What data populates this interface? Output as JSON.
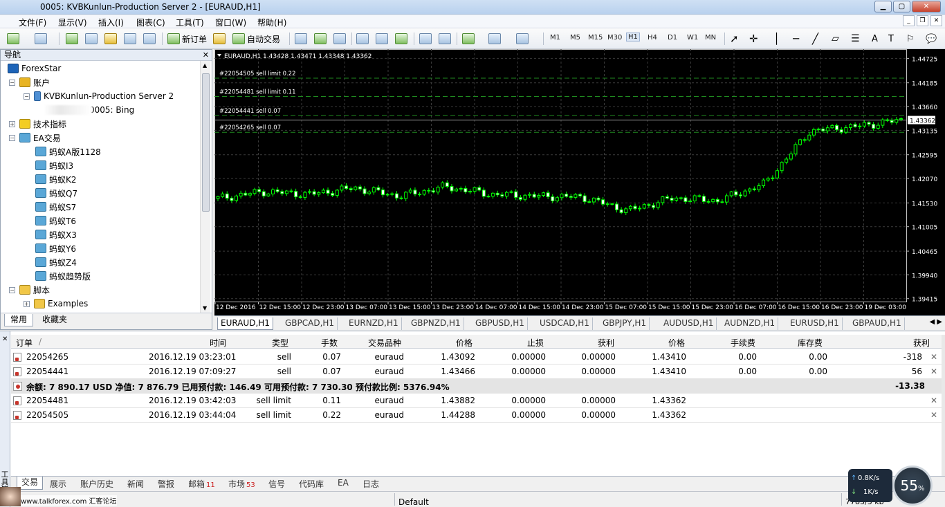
{
  "window": {
    "title": "0005: KVBKunlun-Production Server 2 - [EURAUD,H1]"
  },
  "menu": [
    "文件(F)",
    "显示(V)",
    "插入(I)",
    "图表(C)",
    "工具(T)",
    "窗口(W)",
    "帮助(H)"
  ],
  "toolbar": {
    "new_order": "新订单",
    "auto_trade": "自动交易",
    "timeframes": [
      "M1",
      "M5",
      "M15",
      "M30",
      "H1",
      "H4",
      "D1",
      "W1",
      "MN"
    ],
    "selected_timeframe": "H1"
  },
  "navigator": {
    "title": "导航",
    "items": [
      {
        "label": "ForexStar",
        "level": 0,
        "icon": "fx-icon"
      },
      {
        "label": "账户",
        "level": 1,
        "icon": "accounts-icon"
      },
      {
        "label": "KVBKunlun-Production Server 2",
        "level": 2,
        "icon": "server-icon"
      },
      {
        "label": "0005: Bing",
        "level": 3,
        "icon": "account-icon"
      },
      {
        "label": "技术指标",
        "level": 1,
        "icon": "indicator-icon"
      },
      {
        "label": "EA交易",
        "level": 1,
        "icon": "ea-icon"
      },
      {
        "label": "蚂蚁A版1128",
        "level": 2,
        "icon": "ea-icon"
      },
      {
        "label": "蚂蚁I3",
        "level": 2,
        "icon": "ea-icon"
      },
      {
        "label": "蚂蚁K2",
        "level": 2,
        "icon": "ea-icon"
      },
      {
        "label": "蚂蚁Q7",
        "level": 2,
        "icon": "ea-icon"
      },
      {
        "label": "蚂蚁S7",
        "level": 2,
        "icon": "ea-icon"
      },
      {
        "label": "蚂蚁T6",
        "level": 2,
        "icon": "ea-icon"
      },
      {
        "label": "蚂蚁X3",
        "level": 2,
        "icon": "ea-icon"
      },
      {
        "label": "蚂蚁Y6",
        "level": 2,
        "icon": "ea-icon"
      },
      {
        "label": "蚂蚁Z4",
        "level": 2,
        "icon": "ea-icon"
      },
      {
        "label": "蚂蚁趋势版",
        "level": 2,
        "icon": "ea-icon"
      },
      {
        "label": "脚本",
        "level": 1,
        "icon": "script-icon"
      },
      {
        "label": "Examples",
        "level": 2,
        "icon": "script-icon"
      }
    ],
    "tabs": [
      "常用",
      "收藏夹"
    ]
  },
  "chart": {
    "header": "EURAUD,H1  1.43428 1.43471 1.43348 1.43362",
    "current_price": "1.43362",
    "order_lines": [
      {
        "label": "#22054505 sell limit 0.22",
        "price": 1.44288
      },
      {
        "label": "#22054481 sell limit 0.11",
        "price": 1.43882
      },
      {
        "label": "#22054441 sell 0.07",
        "price": 1.43466
      },
      {
        "label": "#22054265 sell 0.07",
        "price": 1.43092
      }
    ],
    "price_axis": [
      "1.44725",
      "1.44185",
      "1.43660",
      "1.43135",
      "1.42595",
      "1.42070",
      "1.41530",
      "1.41005",
      "1.40465",
      "1.39940",
      "1.39415"
    ],
    "time_axis": [
      "12 Dec 2016",
      "12 Dec 15:00",
      "12 Dec 23:00",
      "13 Dec 07:00",
      "13 Dec 15:00",
      "13 Dec 23:00",
      "14 Dec 07:00",
      "14 Dec 15:00",
      "14 Dec 23:00",
      "15 Dec 07:00",
      "15 Dec 15:00",
      "15 Dec 23:00",
      "16 Dec 07:00",
      "16 Dec 15:00",
      "16 Dec 23:00",
      "19 Dec 03:00"
    ],
    "colors": {
      "background": "#000000",
      "candle": "#00ff00",
      "grid": "#3a3a3a",
      "order_line": "#1f8a1f"
    }
  },
  "chart_data": {
    "type": "candlestick",
    "symbol": "EURAUD",
    "timeframe": "H1",
    "x": [
      "12 Dec 2016",
      "12 Dec 15:00",
      "12 Dec 23:00",
      "13 Dec 07:00",
      "13 Dec 15:00",
      "13 Dec 23:00",
      "14 Dec 07:00",
      "14 Dec 15:00",
      "14 Dec 23:00",
      "15 Dec 07:00",
      "15 Dec 15:00",
      "15 Dec 23:00",
      "16 Dec 07:00",
      "16 Dec 15:00",
      "16 Dec 23:00",
      "19 Dec 03:00"
    ],
    "close_series": [
      1.4163,
      1.4178,
      1.4172,
      1.4186,
      1.4168,
      1.4189,
      1.4172,
      1.4168,
      1.4166,
      1.4136,
      1.4164,
      1.4158,
      1.4195,
      1.4312,
      1.4322,
      1.4336
    ],
    "ylim": [
      1.3935,
      1.4493
    ],
    "grid": true
  },
  "chart_tabs": [
    "EURAUD,H1",
    "GBPCAD,H1",
    "EURNZD,H1",
    "GBPNZD,H1",
    "GBPUSD,H1",
    "USDCAD,H1",
    "GBPJPY,H1",
    "AUDUSD,H1",
    "AUDNZD,H1",
    "EURUSD,H1",
    "GBPAUD,H1"
  ],
  "terminal": {
    "columns": [
      "订单",
      "时间",
      "类型",
      "手数",
      "交易品种",
      "价格",
      "止损",
      "获利",
      "价格",
      "手续费",
      "库存费",
      "获利"
    ],
    "rows": [
      [
        "22054265",
        "2016.12.19 03:23:01",
        "sell",
        "0.07",
        "euraud",
        "1.43092",
        "0.00000",
        "0.00000",
        "1.43410",
        "0.00",
        "0.00",
        "-318"
      ],
      [
        "22054441",
        "2016.12.19 07:09:27",
        "sell",
        "0.07",
        "euraud",
        "1.43466",
        "0.00000",
        "0.00000",
        "1.43410",
        "0.00",
        "0.00",
        "56"
      ]
    ],
    "summary": {
      "text": "余额: 7 890.17 USD  净值: 7 876.79  已用预付款: 146.49  可用预付款: 7 730.30  预付款比例: 5376.94%",
      "profit": "-13.38"
    },
    "pending": [
      [
        "22054481",
        "2016.12.19 03:42:03",
        "sell limit",
        "0.11",
        "euraud",
        "1.43882",
        "0.00000",
        "0.00000",
        "1.43362"
      ],
      [
        "22054505",
        "2016.12.19 03:44:04",
        "sell limit",
        "0.22",
        "euraud",
        "1.44288",
        "0.00000",
        "0.00000",
        "1.43362"
      ]
    ]
  },
  "bottom_tabs": [
    {
      "label": "交易",
      "count": ""
    },
    {
      "label": "展示",
      "count": ""
    },
    {
      "label": "账户历史",
      "count": ""
    },
    {
      "label": "新闻",
      "count": ""
    },
    {
      "label": "警报",
      "count": ""
    },
    {
      "label": "邮箱",
      "count": "11"
    },
    {
      "label": "市场",
      "count": "53"
    },
    {
      "label": "信号",
      "count": ""
    },
    {
      "label": "代码库",
      "count": ""
    },
    {
      "label": "EA",
      "count": ""
    },
    {
      "label": "日志",
      "count": ""
    }
  ],
  "terminal_side_label": "工具箱",
  "status": {
    "profile": "Default",
    "traffic": "7783/3 kb"
  },
  "network": {
    "up": "0.8K/s",
    "down": "1K/s",
    "cpu": "55",
    "cpu_unit": "%"
  },
  "watermark": "www.talkforex.com 汇客论坛"
}
